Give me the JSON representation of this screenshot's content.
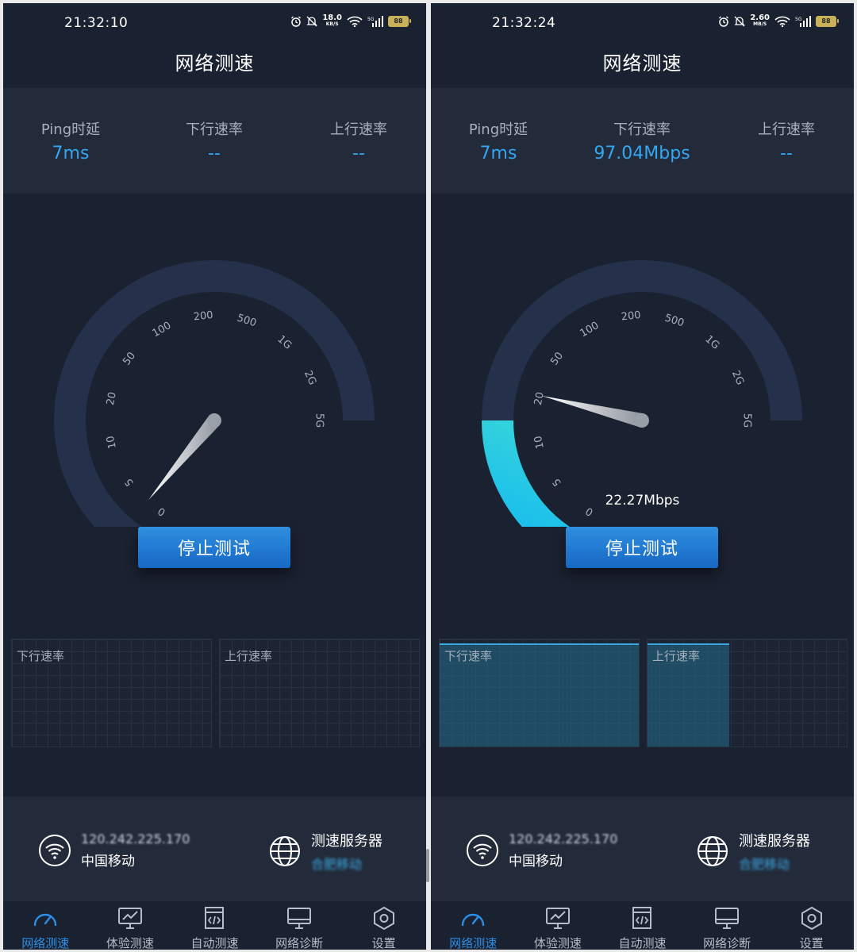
{
  "screens": [
    {
      "status_time": "21:32:10",
      "net_speed_value": "18.0",
      "net_speed_unit": "KB/S",
      "network_type": "5G",
      "battery": "88",
      "title": "网络测速",
      "stats": {
        "ping_label": "Ping时延",
        "ping_value": "7ms",
        "down_label": "下行速率",
        "down_value": "--",
        "up_label": "上行速率",
        "up_value": "--"
      },
      "gauge": {
        "scale_labels": [
          "0",
          "5",
          "10",
          "20",
          "50",
          "100",
          "200",
          "500",
          "1G",
          "2G",
          "5G"
        ],
        "current_speed_text": "",
        "progress_fraction": 0.0,
        "needle_scale_value": "2"
      },
      "stop_button_label": "停止测试",
      "charts": {
        "down_label": "下行速率",
        "up_label": "上行速率",
        "down_fill_fraction": 0.0,
        "up_fill_fraction": 0.0
      },
      "info": {
        "ip": "120.242.225.170",
        "isp": "中国移动",
        "server_title": "测速服务器",
        "server_name": "合肥移动"
      },
      "tabs": [
        {
          "label": "网络测速",
          "icon": "speedometer-icon",
          "active": true
        },
        {
          "label": "体验测速",
          "icon": "monitor-chart-icon",
          "active": false
        },
        {
          "label": "自动测速",
          "icon": "code-doc-icon",
          "active": false
        },
        {
          "label": "网络诊断",
          "icon": "desktop-icon",
          "active": false
        },
        {
          "label": "设置",
          "icon": "settings-hexagon-icon",
          "active": false
        }
      ]
    },
    {
      "status_time": "21:32:24",
      "net_speed_value": "2.60",
      "net_speed_unit": "MB/S",
      "network_type": "5G",
      "battery": "88",
      "title": "网络测速",
      "stats": {
        "ping_label": "Ping时延",
        "ping_value": "7ms",
        "down_label": "下行速率",
        "down_value": "97.04Mbps",
        "up_label": "上行速率",
        "up_value": "--"
      },
      "gauge": {
        "scale_labels": [
          "0",
          "5",
          "10",
          "20",
          "50",
          "100",
          "200",
          "500",
          "1G",
          "2G",
          "5G"
        ],
        "current_speed_text": "22.27Mbps",
        "progress_fraction": 0.25,
        "needle_scale_value": "22.27"
      },
      "stop_button_label": "停止测试",
      "charts": {
        "down_label": "下行速率",
        "up_label": "上行速率",
        "down_fill_fraction": 1.0,
        "up_fill_fraction": 0.41
      },
      "info": {
        "ip": "120.242.225.170",
        "isp": "中国移动",
        "server_title": "测速服务器",
        "server_name": "合肥移动"
      },
      "tabs": [
        {
          "label": "网络测速",
          "icon": "speedometer-icon",
          "active": true
        },
        {
          "label": "体验测速",
          "icon": "monitor-chart-icon",
          "active": false
        },
        {
          "label": "自动测速",
          "icon": "code-doc-icon",
          "active": false
        },
        {
          "label": "网络诊断",
          "icon": "desktop-icon",
          "active": false
        },
        {
          "label": "设置",
          "icon": "settings-hexagon-icon",
          "active": false
        }
      ]
    }
  ]
}
